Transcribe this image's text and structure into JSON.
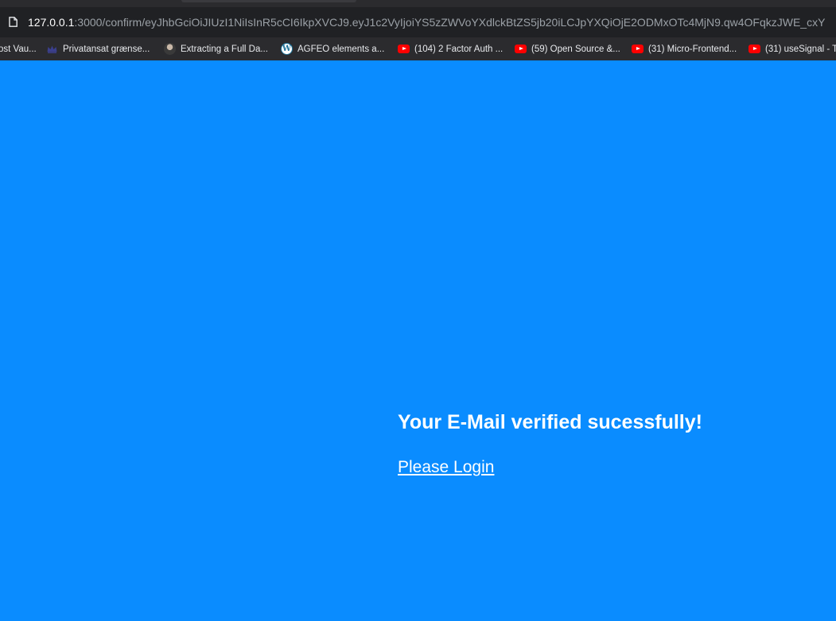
{
  "browser": {
    "address_bar": {
      "host": "127.0.0.1",
      "path": ":3000/confirm/eyJhbGciOiJIUzI1NiIsInR5cCI6IkpXVCJ9.eyJ1c2VyIjoiYS5zZWVoYXdlckBtZS5jb20iLCJpYXQiOjE2ODMxOTc4MjN9.qw4OFqkzJWE_cxY"
    },
    "bookmarks": [
      {
        "label": "ost Vau...",
        "icon": "none"
      },
      {
        "label": "Privatansat grænse...",
        "icon": "crown-icon"
      },
      {
        "label": "Extracting a Full Da...",
        "icon": "avatar-icon"
      },
      {
        "label": "AGFEO elements a...",
        "icon": "wordpress-icon"
      },
      {
        "label": "(104) 2 Factor Auth ...",
        "icon": "youtube-icon"
      },
      {
        "label": "(59) Open Source &...",
        "icon": "youtube-icon"
      },
      {
        "label": "(31) Micro-Frontend...",
        "icon": "youtube-icon"
      },
      {
        "label": "(31) useSignal - T",
        "icon": "youtube-icon"
      }
    ]
  },
  "page": {
    "heading": "Your E-Mail verified sucessfully!",
    "login_link": "Please Login"
  },
  "colors": {
    "page_background": "#0a8cff",
    "chrome_background": "#202124",
    "bookmarks_background": "#2b2b2e",
    "text": "#ffffff",
    "youtube_red": "#ff0000"
  }
}
